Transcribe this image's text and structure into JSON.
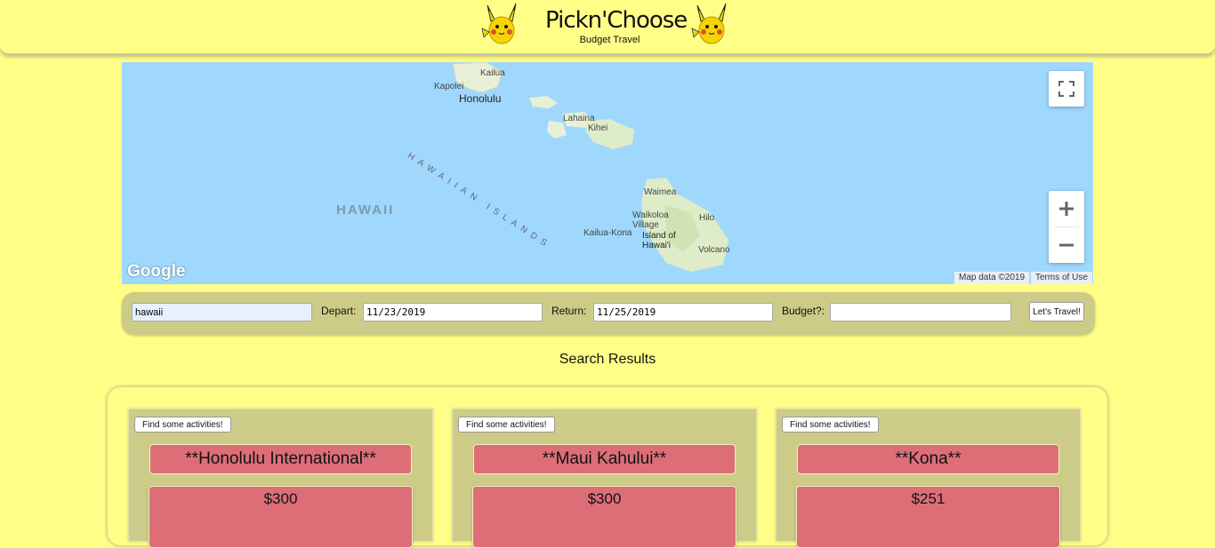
{
  "header": {
    "title": "Pickn'Choose",
    "subtitle": "Budget Travel",
    "mascot_icon": "pikachu-icon"
  },
  "map": {
    "labels": {
      "kailua": "Kailua",
      "kapolei": "Kapolei",
      "honolulu": "Honolulu",
      "lahaina": "Lahaina",
      "kihei": "Kihei",
      "islands": "HAWAIIAN ISLANDS",
      "hawaii": "HAWAII",
      "waimea": "Waimea",
      "waikoloa": "Waikoloa Village",
      "kailua_kona": "Kailua-Kona",
      "island_of_hawaii": "Island of Hawai'i",
      "hilo": "Hilo",
      "volcano": "Volcano"
    },
    "logo": "Google",
    "map_data": "Map data ©2019",
    "terms": "Terms of Use",
    "colors": {
      "water": "#9fd8fc",
      "land": "#e8f0d8"
    }
  },
  "search": {
    "destination": "hawaii",
    "depart_label": "Depart:",
    "depart_value": "11/23/2019",
    "return_label": "Return:",
    "return_value": "11/25/2019",
    "budget_label": "Budget?:",
    "budget_value": "",
    "submit_label": "Let's Travel!"
  },
  "results": {
    "title": "Search Results",
    "activities_label": "Find some activities!",
    "cards": [
      {
        "airport": "**Honolulu International**",
        "price": "$300"
      },
      {
        "airport": "**Maui Kahului**",
        "price": "$300"
      },
      {
        "airport": "**Kona**",
        "price": "$251"
      }
    ]
  },
  "colors": {
    "background": "#ffff88",
    "panel": "#cccc88",
    "card_accent": "#dd6e78"
  }
}
